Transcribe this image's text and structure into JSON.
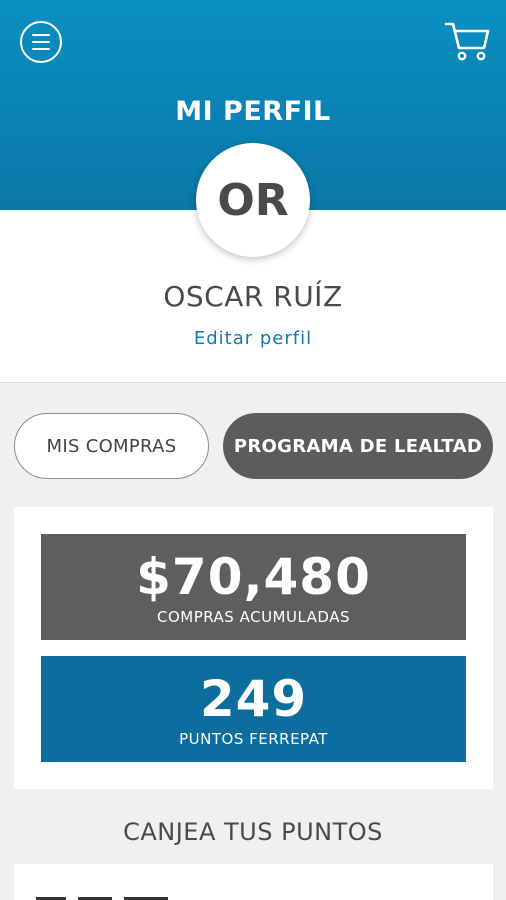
{
  "header": {
    "title": "MI PERFIL",
    "menu_icon": "menu-icon",
    "cart_icon": "cart-icon",
    "color": "#0a8fc2"
  },
  "profile": {
    "initials": "OR",
    "name": "OSCAR RUÍZ",
    "edit_label": "Editar perfil"
  },
  "tabs": {
    "mis_compras": "MIS COMPRAS",
    "programa_lealtad": "PROGRAMA DE LEALTAD"
  },
  "stats": {
    "compras_value": "$70,480",
    "compras_label": "COMPRAS ACUMULADAS",
    "puntos_value": "249",
    "puntos_label": "PUNTOS FERREPAT"
  },
  "rewards": {
    "title": "CANJEA TUS PUNTOS"
  },
  "colors": {
    "primary_blue": "#0b6e9e",
    "dark_gray": "#5e5e60",
    "link_blue": "#1479a8"
  }
}
